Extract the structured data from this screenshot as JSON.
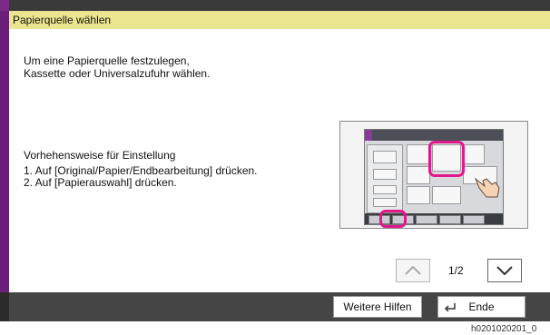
{
  "header": {
    "title": "Papierquelle wählen"
  },
  "intro": {
    "line1": "Um eine Papierquelle festzulegen,",
    "line2": "Kassette oder Universalzufuhr wählen."
  },
  "procedure": {
    "title": "Vorhehensweise für Einstellung",
    "steps": [
      "1. Auf [Original/Papier/Endbearbeitung] drücken.",
      "2. Auf [Papierauswahl] drücken."
    ]
  },
  "pager": {
    "page": "1/2"
  },
  "footer": {
    "help_label": "Weitere Hilfen",
    "end_label": "Ende"
  },
  "caption": "h0201020201_0",
  "colors": {
    "title_bg": "#ece58f",
    "accent": "#6a1f7a",
    "highlight": "#e2178c"
  }
}
